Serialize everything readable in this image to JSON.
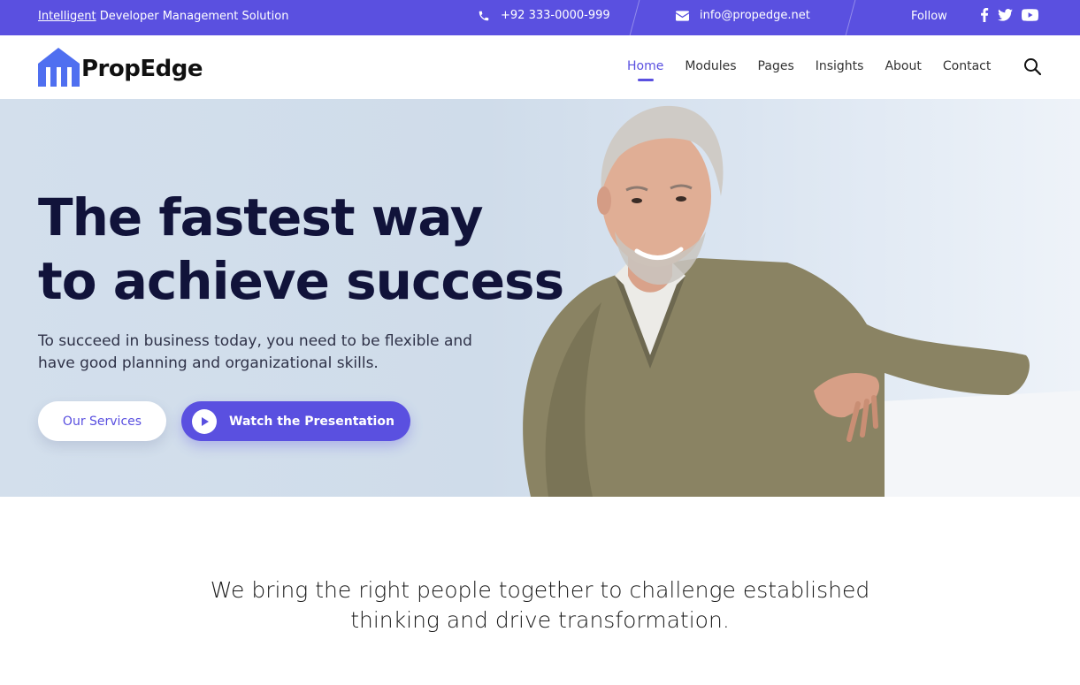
{
  "topbar": {
    "tagline_link": "Intelligent",
    "tagline_rest": " Developer Management Solution",
    "phone": "+92 333-0000-999",
    "email": "info@propedge.net",
    "follow_label": "Follow",
    "social_icons": [
      "facebook-icon",
      "twitter-icon",
      "youtube-icon"
    ]
  },
  "header": {
    "logo_text": "PropEdge",
    "nav": [
      {
        "label": "Home",
        "active": true
      },
      {
        "label": "Modules"
      },
      {
        "label": "Pages"
      },
      {
        "label": "Insights"
      },
      {
        "label": "About"
      },
      {
        "label": "Contact"
      }
    ]
  },
  "hero": {
    "title_line1": "The fastest way",
    "title_line2": "to achieve success",
    "lead": "To succeed in business today, you need to be flexible and have good planning and organizational skills.",
    "btn_services": "Our Services",
    "btn_watch": "Watch the Presentation"
  },
  "intro": {
    "line1": "We bring the right people together to challenge established",
    "line2": "thinking and drive transformation."
  },
  "colors": {
    "accent": "#5a50e0",
    "heading": "#11133a",
    "hero_bg": "#d3dfec"
  }
}
